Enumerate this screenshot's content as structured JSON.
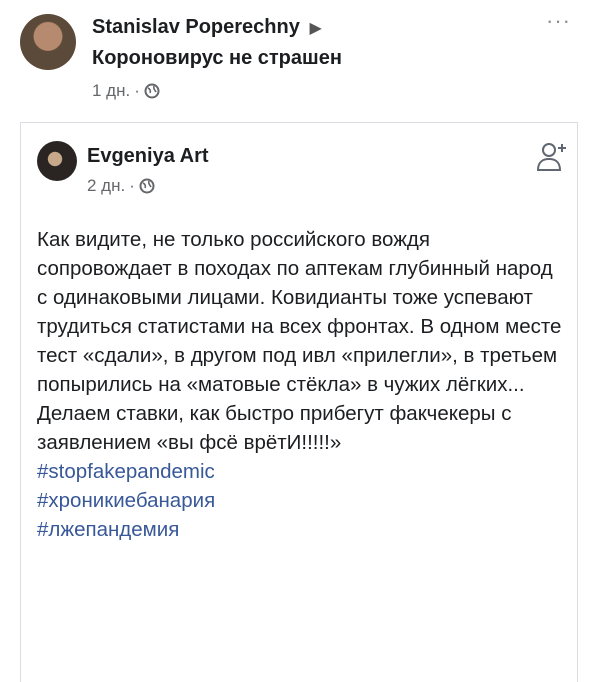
{
  "post": {
    "author": "Stanislav Poperechny",
    "arrow": "▶",
    "group": "Короновирус не страшен",
    "time": "1 дн.",
    "dot": "·",
    "more": "···"
  },
  "shared": {
    "author": "Evgeniya Art",
    "time": "2 дн.",
    "dot": "·",
    "text": "Как видите, не только российского вождя сопровождает в походах по аптекам глубинный народ с одинаковыми лицами. Ковидианты тоже успевают трудиться статистами на всех фронтах. В одном месте тест «сдали», в другом под ивл «прилегли», в третьем попырились на «матовые стёкла» в чужих лёгких... Делаем ставки, как быстро прибегут факчекеры с заявлением «вы фсё врётИ!!!!!»",
    "hashtags": [
      "#stopfakepandemic",
      "#хроникиебанария",
      "#лжепандемия"
    ]
  },
  "colors": {
    "link": "#385898",
    "meta": "#65676b",
    "text": "#1c1e21"
  },
  "icons": [
    "globe-icon",
    "more-options-icon",
    "add-friend-icon",
    "arrow-right-icon"
  ]
}
